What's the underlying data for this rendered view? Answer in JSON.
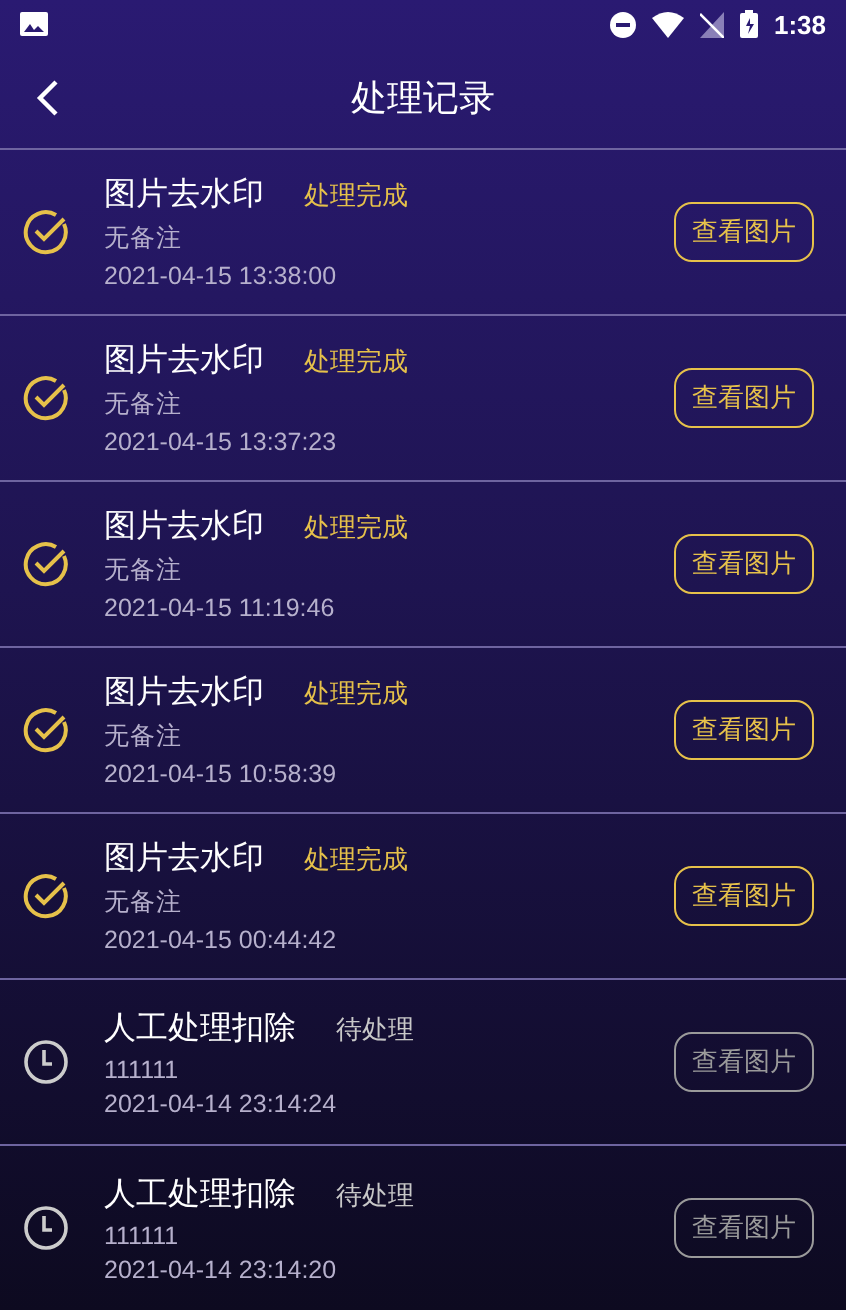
{
  "status_bar": {
    "time": "1:38"
  },
  "header": {
    "title": "处理记录"
  },
  "records": [
    {
      "kind": "done",
      "title": "图片去水印",
      "status": "处理完成",
      "note": "无备注",
      "time": "2021-04-15 13:38:00",
      "button": "查看图片"
    },
    {
      "kind": "done",
      "title": "图片去水印",
      "status": "处理完成",
      "note": "无备注",
      "time": "2021-04-15 13:37:23",
      "button": "查看图片"
    },
    {
      "kind": "done",
      "title": "图片去水印",
      "status": "处理完成",
      "note": "无备注",
      "time": "2021-04-15 11:19:46",
      "button": "查看图片"
    },
    {
      "kind": "done",
      "title": "图片去水印",
      "status": "处理完成",
      "note": "无备注",
      "time": "2021-04-15 10:58:39",
      "button": "查看图片"
    },
    {
      "kind": "done",
      "title": "图片去水印",
      "status": "处理完成",
      "note": "无备注",
      "time": "2021-04-15 00:44:42",
      "button": "查看图片"
    },
    {
      "kind": "pending",
      "title": "人工处理扣除",
      "status": "待处理",
      "note": "111111",
      "time": "2021-04-14 23:14:24",
      "button": "查看图片"
    },
    {
      "kind": "pending",
      "title": "人工处理扣除",
      "status": "待处理",
      "note": "111111",
      "time": "2021-04-14 23:14:20",
      "button": "查看图片"
    }
  ]
}
